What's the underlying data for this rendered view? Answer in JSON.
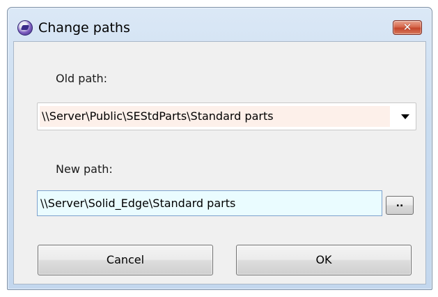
{
  "window": {
    "title": "Change paths",
    "close_label": "✕",
    "icon": "app-icon"
  },
  "old_path": {
    "label": "Old path:",
    "value": "\\\\Server\\Public\\SEStdParts\\Standard parts"
  },
  "new_path": {
    "label": "New path:",
    "value": "\\\\Server\\Solid_Edge\\Standard parts",
    "browse_label": ".."
  },
  "buttons": {
    "cancel": "Cancel",
    "ok": "OK"
  },
  "colors": {
    "old_path_bg": "#fdf0ea",
    "new_path_bg": "#eafcff",
    "close_btn": "#c4452b"
  }
}
